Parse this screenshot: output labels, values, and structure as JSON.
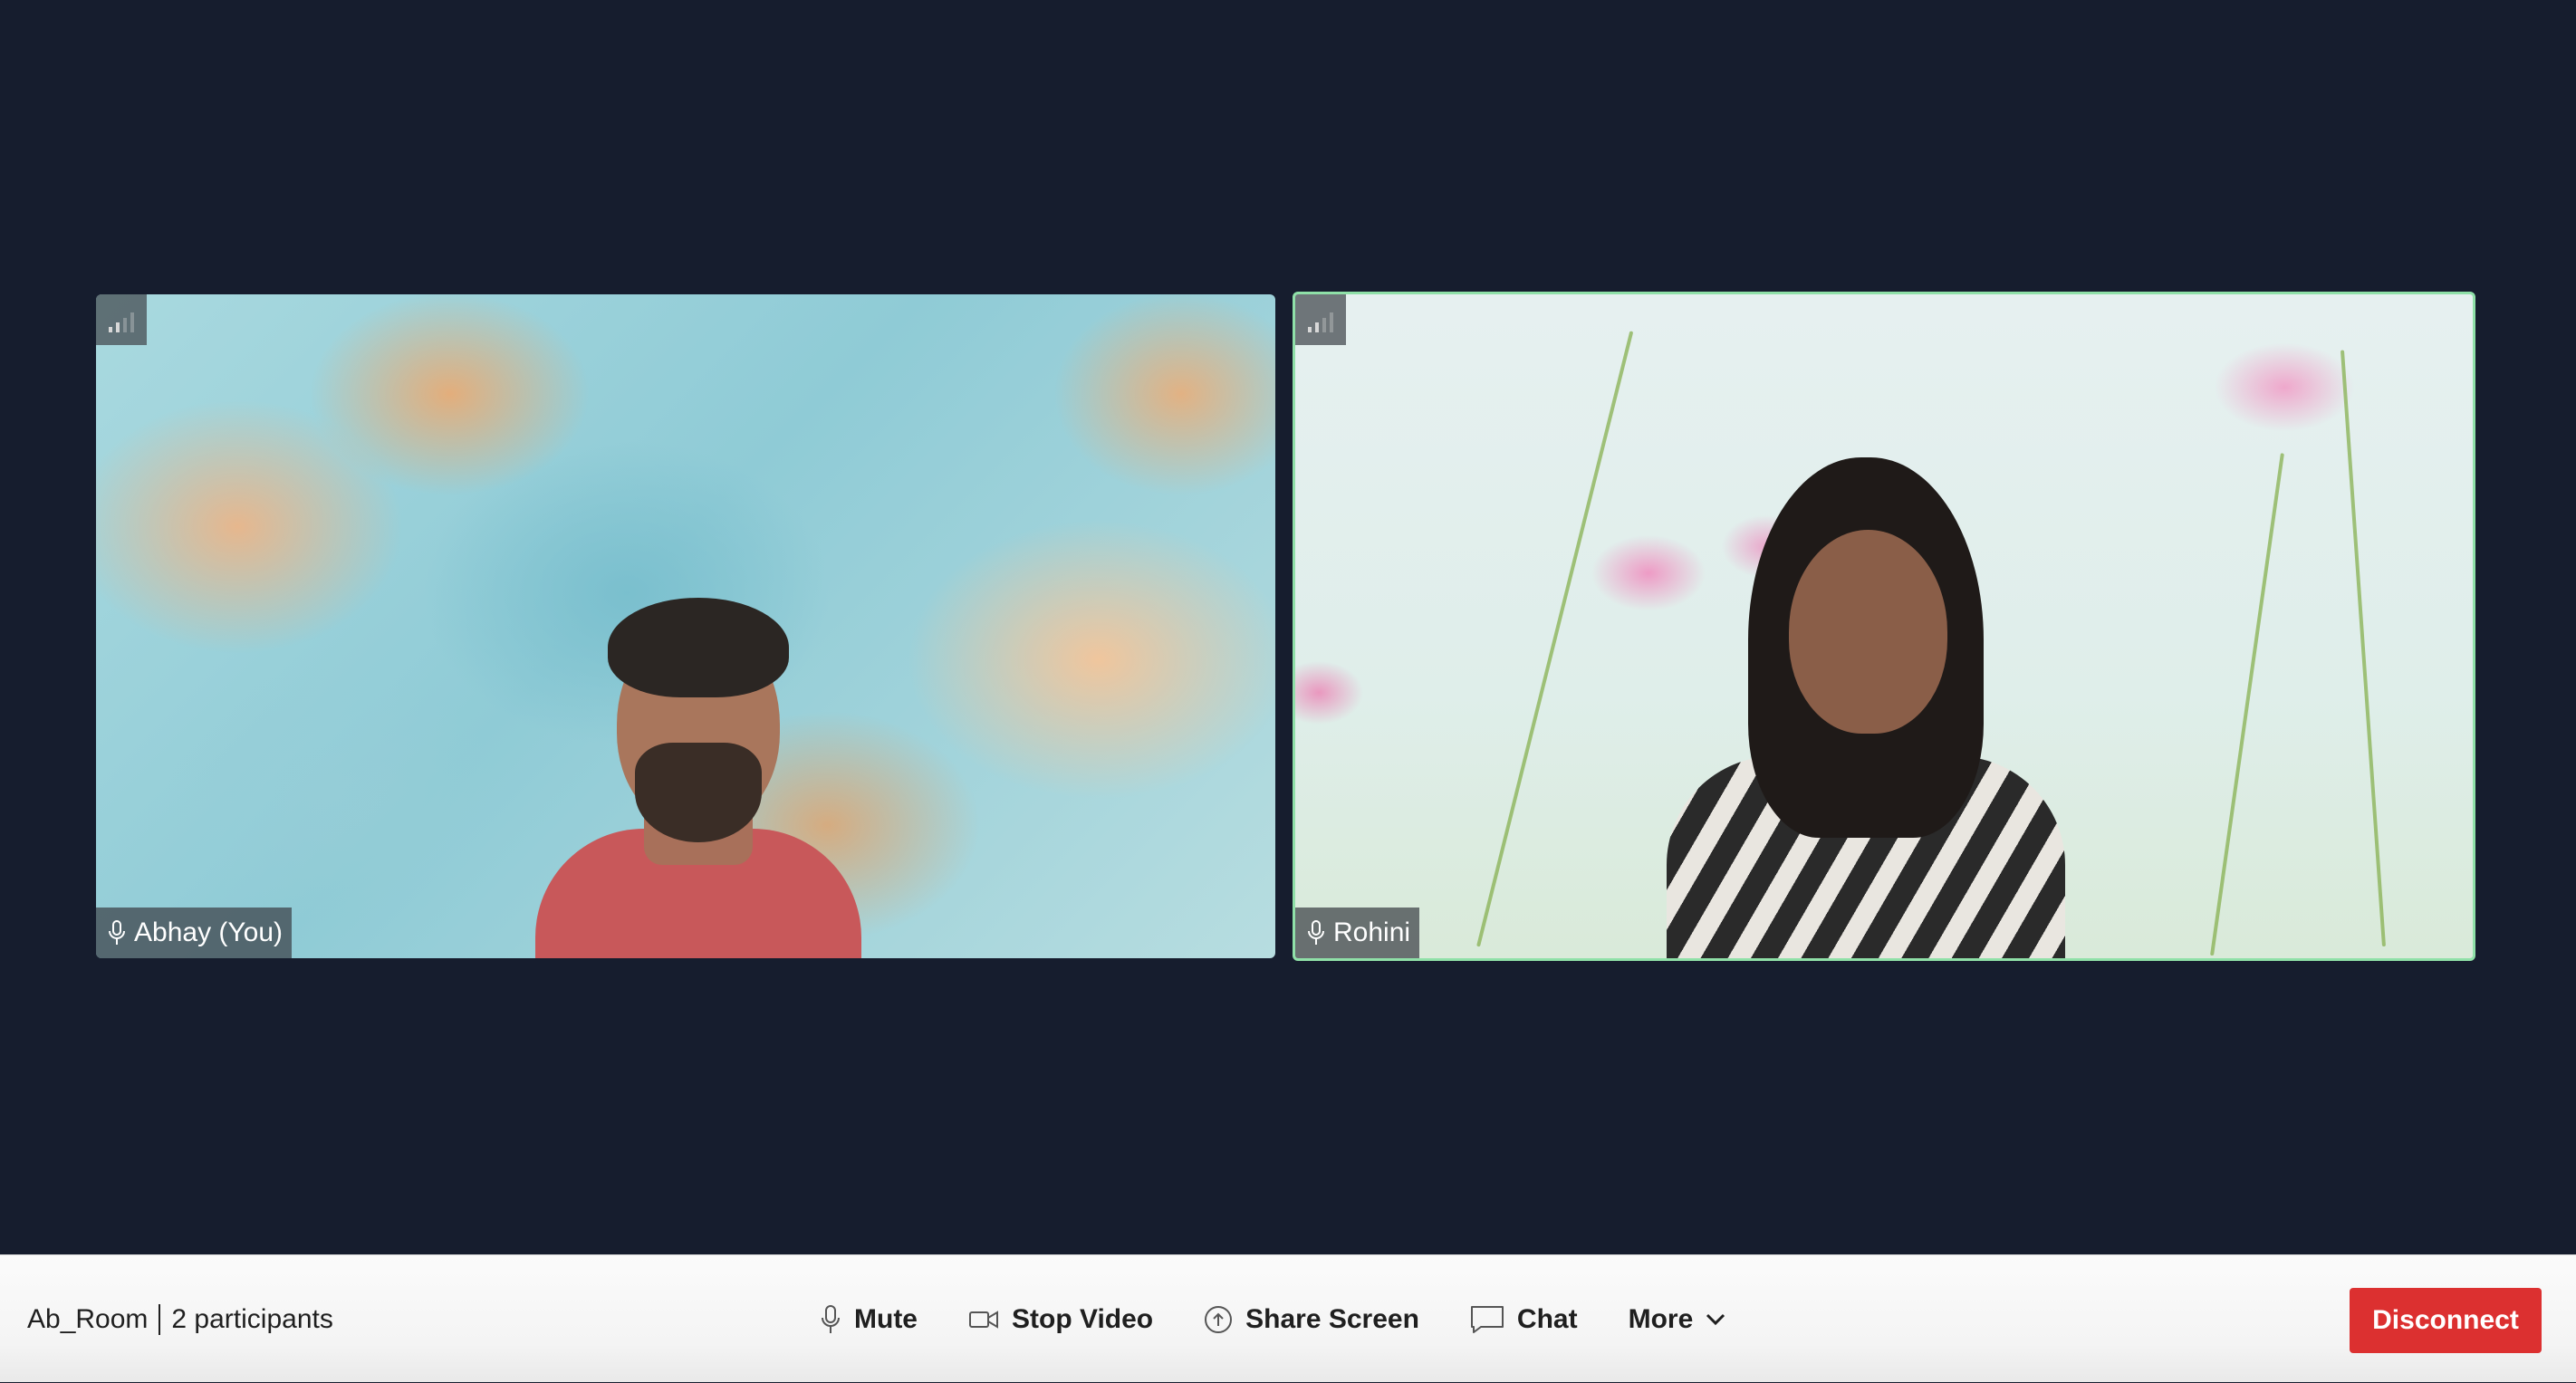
{
  "room": {
    "name": "Ab_Room",
    "participants": "2 participants"
  },
  "participants": [
    {
      "name": "Abhay (You)",
      "speaking": false
    },
    {
      "name": "Rohini",
      "speaking": true
    }
  ],
  "toolbar": {
    "mute_label": "Mute",
    "stop_video_label": "Stop Video",
    "share_screen_label": "Share Screen",
    "chat_label": "Chat",
    "more_label": "More",
    "disconnect_label": "Disconnect"
  },
  "colors": {
    "background": "#161d2e",
    "active_speaker_border": "#8fe0a8",
    "disconnect": "#dc3030"
  },
  "icons": {
    "signal": "network-quality-icon",
    "mic": "microphone-icon",
    "camera": "video-camera-icon",
    "share": "share-screen-icon",
    "chat": "chat-bubble-icon",
    "more": "chevron-down-icon"
  }
}
